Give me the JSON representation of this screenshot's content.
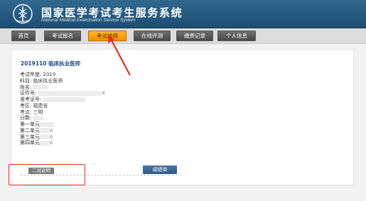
{
  "header": {
    "title": "国家医学考试考生服务系统",
    "subtitle": "National Medical Examination Service System"
  },
  "nav": {
    "items": [
      {
        "label": "首页",
        "active": false
      },
      {
        "label": "考试报名",
        "active": false
      },
      {
        "label": "考试成绩",
        "active": true
      },
      {
        "label": "在线评测",
        "active": false
      },
      {
        "label": "缴费记录",
        "active": false
      },
      {
        "label": "个人信息",
        "active": false
      }
    ]
  },
  "result": {
    "exam_title": "2019110  临床执业医师",
    "rows": [
      {
        "label": "考试年度:",
        "value": "2019"
      },
      {
        "label": "科目:",
        "value": "临床执业医师"
      },
      {
        "label": "姓名:",
        "value": ""
      },
      {
        "label": "证件号:",
        "value": "",
        "tail": "X"
      },
      {
        "label": "准考证号:",
        "value": ""
      },
      {
        "label": "考区:",
        "value": "福建省"
      },
      {
        "label": "考点:",
        "value": "三明"
      },
      {
        "label": "分数:",
        "value": ""
      },
      {
        "label": "第一单元",
        "value": ""
      },
      {
        "label": "第二单元",
        "value": "",
        "tail": "0"
      },
      {
        "label": "第三单元",
        "value": "",
        "tail": "0"
      },
      {
        "label": "第四单元",
        "value": "",
        "tail": "0"
      }
    ],
    "note_button": "二试说明",
    "report_button": "成绩单"
  },
  "colors": {
    "header": "#2a5f87",
    "active_tab": "#f7a21b",
    "annotation": "#e0322a",
    "title_text": "#1d4e86"
  }
}
